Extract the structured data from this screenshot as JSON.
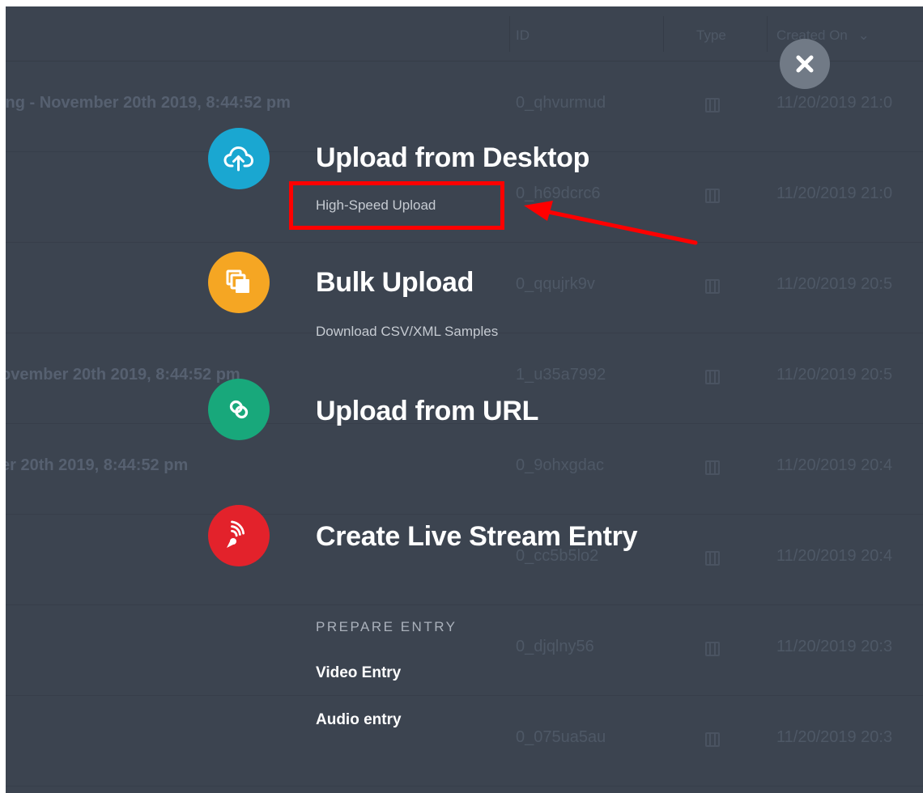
{
  "background_table": {
    "columns": {
      "id": "ID",
      "type": "Type",
      "created_on": "Created On"
    },
    "rows": [
      {
        "name": "ing - November 20th 2019, 8:44:52 pm",
        "id": "0_qhvurmud",
        "date": "11/20/2019 21:0"
      },
      {
        "name": "",
        "id": "0_h69dcrc6",
        "date": "11/20/2019 21:0"
      },
      {
        "name": "",
        "id": "0_qqujrk9v",
        "date": "11/20/2019 20:5"
      },
      {
        "name": "ovember 20th 2019, 8:44:52 pm",
        "id": "1_u35a7992",
        "date": "11/20/2019 20:5"
      },
      {
        "name": "er 20th 2019, 8:44:52 pm",
        "id": "0_9ohxgdac",
        "date": "11/20/2019 20:4"
      },
      {
        "name": "",
        "id": "0_cc5b5lo2",
        "date": "11/20/2019 20:4"
      },
      {
        "name": "",
        "id": "0_djqlny56",
        "date": "11/20/2019 20:3"
      },
      {
        "name": "",
        "id": "0_075ua5au",
        "date": "11/20/2019 20:3"
      }
    ]
  },
  "menu": {
    "upload_desktop": {
      "title": "Upload from Desktop",
      "subtitle": "High-Speed Upload",
      "icon": "cloud-upload-icon",
      "color": "#1aa7d1"
    },
    "bulk_upload": {
      "title": "Bulk Upload",
      "subtitle": "Download CSV/XML Samples",
      "icon": "copy-icon",
      "color": "#f5a623"
    },
    "upload_url": {
      "title": "Upload from URL",
      "icon": "link-icon",
      "color": "#18a87b"
    },
    "live_stream": {
      "title": "Create Live Stream Entry",
      "icon": "broadcast-icon",
      "color": "#e3222b"
    },
    "prepare": {
      "heading": "PREPARE ENTRY",
      "items": [
        "Video Entry",
        "Audio entry"
      ]
    }
  },
  "close": {
    "icon": "close-icon"
  },
  "annotation": {
    "color": "#ff0000"
  }
}
